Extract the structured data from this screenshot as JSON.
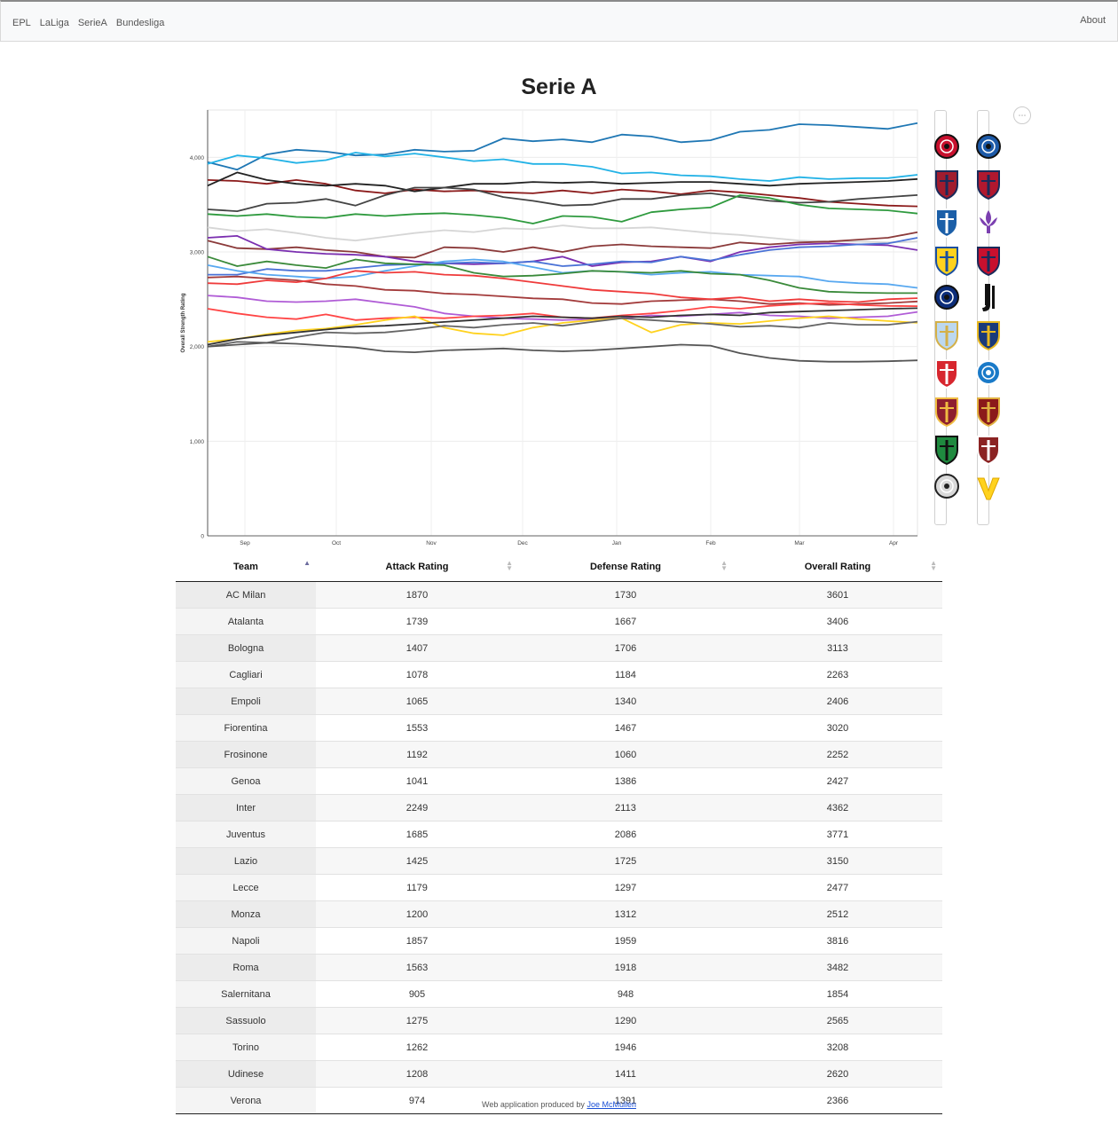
{
  "nav": {
    "items": [
      "EPL",
      "LaLiga",
      "SerieA",
      "Bundesliga"
    ],
    "about": "About"
  },
  "page_title": "Serie A",
  "more_icon": "⋯",
  "chart_data": {
    "type": "line",
    "title": "",
    "xlabel": "",
    "ylabel": "Overall Strength Rating",
    "x_ticks": [
      "Sep",
      "Oct",
      "Nov",
      "Dec",
      "Jan",
      "Feb",
      "Mar",
      "Apr"
    ],
    "y_ticks": [
      "0",
      "1,000",
      "2,000",
      "3,000",
      "4,000"
    ],
    "ylim": [
      0,
      4500
    ],
    "grid": true,
    "series": [
      {
        "color": "#1f77b4",
        "values": [
          3950,
          3870,
          4030,
          4080,
          4060,
          4020,
          4030,
          4080,
          4060,
          4070,
          4200,
          4170,
          4190,
          4160,
          4240,
          4220,
          4160,
          4180,
          4270,
          4290,
          4350,
          4340,
          4320,
          4300,
          4362
        ]
      },
      {
        "color": "#22b2e6",
        "values": [
          3930,
          4020,
          3990,
          3940,
          3970,
          4050,
          4010,
          4040,
          4000,
          3960,
          3980,
          3930,
          3930,
          3900,
          3830,
          3840,
          3810,
          3800,
          3770,
          3750,
          3790,
          3770,
          3780,
          3780,
          3816
        ]
      },
      {
        "color": "#8b1a1a",
        "values": [
          3760,
          3750,
          3720,
          3760,
          3720,
          3650,
          3620,
          3660,
          3640,
          3650,
          3630,
          3620,
          3650,
          3620,
          3660,
          3640,
          3610,
          3650,
          3630,
          3600,
          3570,
          3530,
          3510,
          3490,
          3482
        ]
      },
      {
        "color": "#222222",
        "values": [
          3700,
          3840,
          3760,
          3720,
          3700,
          3720,
          3700,
          3640,
          3680,
          3720,
          3720,
          3740,
          3730,
          3740,
          3720,
          3730,
          3740,
          3740,
          3720,
          3700,
          3720,
          3730,
          3740,
          3750,
          3771
        ]
      },
      {
        "color": "#444444",
        "values": [
          3450,
          3430,
          3510,
          3520,
          3560,
          3490,
          3600,
          3680,
          3680,
          3660,
          3580,
          3540,
          3490,
          3500,
          3560,
          3560,
          3600,
          3620,
          3580,
          3540,
          3520,
          3530,
          3560,
          3580,
          3601
        ]
      },
      {
        "color": "#2e9a3e",
        "values": [
          3400,
          3380,
          3400,
          3370,
          3360,
          3400,
          3380,
          3400,
          3410,
          3390,
          3360,
          3300,
          3380,
          3370,
          3320,
          3420,
          3450,
          3470,
          3600,
          3570,
          3500,
          3460,
          3450,
          3440,
          3406
        ]
      },
      {
        "color": "#d6d6d6",
        "values": [
          3260,
          3220,
          3240,
          3200,
          3150,
          3120,
          3160,
          3200,
          3230,
          3210,
          3250,
          3240,
          3280,
          3250,
          3250,
          3260,
          3230,
          3200,
          3180,
          3150,
          3120,
          3110,
          3110,
          3100,
          3110
        ]
      },
      {
        "color": "#8b3a3a",
        "values": [
          3120,
          3040,
          3030,
          3050,
          3020,
          3000,
          2950,
          2940,
          3050,
          3040,
          3000,
          3050,
          3000,
          3060,
          3080,
          3060,
          3050,
          3040,
          3100,
          3080,
          3100,
          3110,
          3130,
          3150,
          3208
        ]
      },
      {
        "color": "#7b2fb0",
        "values": [
          3150,
          3170,
          3030,
          3000,
          2980,
          2970,
          2950,
          2900,
          2880,
          2870,
          2880,
          2900,
          2950,
          2850,
          2890,
          2900,
          2950,
          2900,
          3000,
          3050,
          3080,
          3090,
          3080,
          3070,
          3020
        ]
      },
      {
        "color": "#4a72d6",
        "values": [
          2760,
          2760,
          2820,
          2800,
          2800,
          2830,
          2860,
          2870,
          2880,
          2890,
          2880,
          2900,
          2850,
          2870,
          2900,
          2890,
          2950,
          2910,
          2970,
          3020,
          3050,
          3060,
          3080,
          3090,
          3150
        ]
      },
      {
        "color": "#58a8f0",
        "values": [
          2860,
          2800,
          2760,
          2740,
          2720,
          2740,
          2800,
          2850,
          2900,
          2920,
          2900,
          2840,
          2780,
          2800,
          2790,
          2760,
          2780,
          2790,
          2760,
          2750,
          2740,
          2690,
          2670,
          2660,
          2620
        ]
      },
      {
        "color": "#3a8a3a",
        "values": [
          2950,
          2850,
          2900,
          2860,
          2830,
          2920,
          2880,
          2870,
          2860,
          2780,
          2740,
          2750,
          2770,
          2800,
          2790,
          2780,
          2800,
          2770,
          2760,
          2700,
          2620,
          2580,
          2570,
          2565,
          2565
        ]
      },
      {
        "color": "#a33b3b",
        "values": [
          2730,
          2740,
          2720,
          2700,
          2660,
          2640,
          2600,
          2590,
          2560,
          2550,
          2530,
          2510,
          2500,
          2460,
          2450,
          2480,
          2490,
          2500,
          2480,
          2450,
          2460,
          2440,
          2450,
          2460,
          2477
        ]
      },
      {
        "color": "#ef3b3b",
        "values": [
          2670,
          2660,
          2700,
          2680,
          2720,
          2800,
          2780,
          2790,
          2760,
          2750,
          2720,
          2680,
          2640,
          2600,
          2580,
          2560,
          2520,
          2500,
          2520,
          2480,
          2500,
          2480,
          2470,
          2500,
          2512
        ]
      },
      {
        "color": "#b05cd6",
        "values": [
          2540,
          2520,
          2480,
          2470,
          2480,
          2500,
          2460,
          2420,
          2350,
          2320,
          2300,
          2290,
          2280,
          2290,
          2300,
          2330,
          2320,
          2340,
          2360,
          2330,
          2320,
          2300,
          2310,
          2320,
          2366
        ]
      },
      {
        "color": "#ff4545",
        "values": [
          2400,
          2350,
          2310,
          2290,
          2340,
          2280,
          2300,
          2310,
          2300,
          2320,
          2330,
          2350,
          2310,
          2300,
          2330,
          2350,
          2380,
          2420,
          2400,
          2430,
          2450,
          2460,
          2440,
          2430,
          2427
        ]
      },
      {
        "color": "#ffd21e",
        "values": [
          2050,
          2080,
          2130,
          2170,
          2190,
          2230,
          2280,
          2320,
          2200,
          2140,
          2120,
          2200,
          2250,
          2280,
          2300,
          2150,
          2230,
          2250,
          2240,
          2270,
          2300,
          2320,
          2290,
          2270,
          2252
        ]
      },
      {
        "color": "#666666",
        "values": [
          2000,
          2050,
          2040,
          2100,
          2150,
          2140,
          2150,
          2180,
          2220,
          2200,
          2230,
          2250,
          2220,
          2260,
          2300,
          2280,
          2260,
          2240,
          2210,
          2220,
          2200,
          2250,
          2230,
          2230,
          2263
        ]
      },
      {
        "color": "#333333",
        "values": [
          2020,
          2080,
          2120,
          2150,
          2180,
          2210,
          2220,
          2240,
          2260,
          2280,
          2300,
          2320,
          2310,
          2300,
          2320,
          2310,
          2330,
          2340,
          2330,
          2360,
          2370,
          2380,
          2390,
          2400,
          2406
        ]
      },
      {
        "color": "#555555",
        "values": [
          2000,
          2020,
          2040,
          2030,
          2010,
          1990,
          1950,
          1940,
          1960,
          1970,
          1980,
          1960,
          1950,
          1960,
          1980,
          2000,
          2020,
          2010,
          1930,
          1880,
          1850,
          1840,
          1840,
          1845,
          1854
        ]
      }
    ]
  },
  "logos": [
    {
      "name": "ac-milan-logo-icon",
      "fill": "#c8102e",
      "stripe": "#111111",
      "shape": "circle"
    },
    {
      "name": "atalanta-logo-icon",
      "fill": "#1d5aa8",
      "stripe": "#111111",
      "shape": "circle"
    },
    {
      "name": "bologna-logo-icon",
      "fill": "#a11c2e",
      "stripe": "#1a2a5a",
      "shape": "shield"
    },
    {
      "name": "cagliari-logo-icon",
      "fill": "#b1182f",
      "stripe": "#1a2a5a",
      "shape": "shield"
    },
    {
      "name": "empoli-logo-icon",
      "fill": "#1b5fa8",
      "stripe": "#ffffff",
      "shape": "shield"
    },
    {
      "name": "fiorentina-logo-icon",
      "fill": "#7b3fb0",
      "stripe": "#ffffff",
      "shape": "lily"
    },
    {
      "name": "frosinone-logo-icon",
      "fill": "#ffd21e",
      "stripe": "#1a4fa0",
      "shape": "shield"
    },
    {
      "name": "genoa-logo-icon",
      "fill": "#c8102e",
      "stripe": "#1a2a5a",
      "shape": "shield"
    },
    {
      "name": "inter-logo-icon",
      "fill": "#0c2d7a",
      "stripe": "#111111",
      "shape": "circle"
    },
    {
      "name": "juventus-logo-icon",
      "fill": "#ffffff",
      "stripe": "#111111",
      "shape": "j"
    },
    {
      "name": "lazio-logo-icon",
      "fill": "#bcd8f0",
      "stripe": "#d4b048",
      "shape": "shield"
    },
    {
      "name": "lecce-logo-icon",
      "fill": "#1a3a7a",
      "stripe": "#e8b820",
      "shape": "shield"
    },
    {
      "name": "monza-logo-icon",
      "fill": "#d7262e",
      "stripe": "#ffffff",
      "shape": "shield"
    },
    {
      "name": "napoli-logo-icon",
      "fill": "#1a7ac8",
      "stripe": "#ffffff",
      "shape": "circle"
    },
    {
      "name": "roma-logo-icon",
      "fill": "#8e1f2f",
      "stripe": "#f0bc42",
      "shape": "shield"
    },
    {
      "name": "salernitana-logo-icon",
      "fill": "#8b1a1a",
      "stripe": "#e0b040",
      "shape": "shield"
    },
    {
      "name": "sassuolo-logo-icon",
      "fill": "#1f8a3f",
      "stripe": "#111111",
      "shape": "shield"
    },
    {
      "name": "torino-logo-icon",
      "fill": "#8b2323",
      "stripe": "#ffffff",
      "shape": "shield"
    },
    {
      "name": "udinese-logo-icon",
      "fill": "#d9d9d9",
      "stripe": "#222222",
      "shape": "circle"
    },
    {
      "name": "verona-logo-icon",
      "fill": "#ffd21e",
      "stripe": "#1a2a6a",
      "shape": "v"
    }
  ],
  "table": {
    "headers": [
      "Team",
      "Attack Rating",
      "Defense Rating",
      "Overall Rating"
    ],
    "rows": [
      [
        "AC Milan",
        "1870",
        "1730",
        "3601"
      ],
      [
        "Atalanta",
        "1739",
        "1667",
        "3406"
      ],
      [
        "Bologna",
        "1407",
        "1706",
        "3113"
      ],
      [
        "Cagliari",
        "1078",
        "1184",
        "2263"
      ],
      [
        "Empoli",
        "1065",
        "1340",
        "2406"
      ],
      [
        "Fiorentina",
        "1553",
        "1467",
        "3020"
      ],
      [
        "Frosinone",
        "1192",
        "1060",
        "2252"
      ],
      [
        "Genoa",
        "1041",
        "1386",
        "2427"
      ],
      [
        "Inter",
        "2249",
        "2113",
        "4362"
      ],
      [
        "Juventus",
        "1685",
        "2086",
        "3771"
      ],
      [
        "Lazio",
        "1425",
        "1725",
        "3150"
      ],
      [
        "Lecce",
        "1179",
        "1297",
        "2477"
      ],
      [
        "Monza",
        "1200",
        "1312",
        "2512"
      ],
      [
        "Napoli",
        "1857",
        "1959",
        "3816"
      ],
      [
        "Roma",
        "1563",
        "1918",
        "3482"
      ],
      [
        "Salernitana",
        "905",
        "948",
        "1854"
      ],
      [
        "Sassuolo",
        "1275",
        "1290",
        "2565"
      ],
      [
        "Torino",
        "1262",
        "1946",
        "3208"
      ],
      [
        "Udinese",
        "1208",
        "1411",
        "2620"
      ],
      [
        "Verona",
        "974",
        "1391",
        "2366"
      ]
    ]
  },
  "footer": {
    "text": "Web application produced by ",
    "author": "Joe McMullen"
  }
}
